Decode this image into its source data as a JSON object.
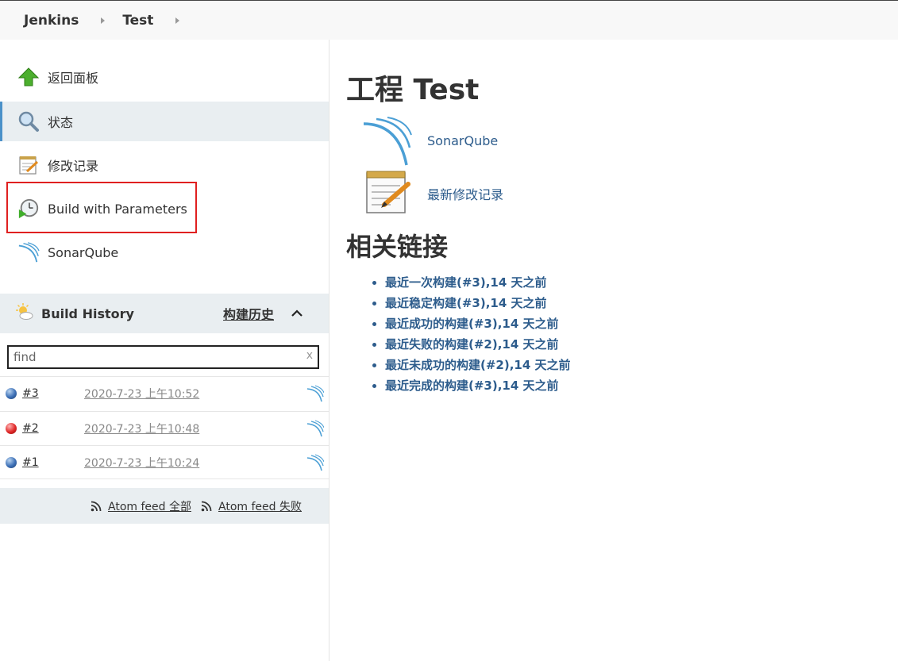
{
  "breadcrumb": {
    "items": [
      {
        "label": "Jenkins"
      },
      {
        "label": "Test"
      }
    ]
  },
  "sidebar": {
    "tasks": [
      {
        "label": "返回面板",
        "icon": "up-arrow-icon"
      },
      {
        "label": "状态",
        "icon": "search-icon",
        "active": true
      },
      {
        "label": "修改记录",
        "icon": "notepad-icon"
      },
      {
        "label": "Build with Parameters",
        "icon": "clock-play-icon"
      },
      {
        "label": "SonarQube",
        "icon": "sonarqube-icon"
      }
    ]
  },
  "build_history": {
    "title": "Build History",
    "trend_label": "构建历史",
    "search": {
      "placeholder": "find",
      "clear_label": "x"
    },
    "builds": [
      {
        "number": "#3",
        "date": "2020-7-23 上午10:52",
        "status_color": "blue"
      },
      {
        "number": "#2",
        "date": "2020-7-23 上午10:48",
        "status_color": "red"
      },
      {
        "number": "#1",
        "date": "2020-7-23 上午10:24",
        "status_color": "blue"
      }
    ],
    "feeds": {
      "all_label": "Atom feed 全部",
      "failed_label": "Atom feed 失败"
    }
  },
  "main": {
    "title": "工程 Test",
    "links": [
      {
        "label": "SonarQube",
        "icon": "sonarqube-icon"
      },
      {
        "label": "最新修改记录",
        "icon": "notepad-icon"
      }
    ],
    "related_title": "相关链接",
    "permalinks": [
      "最近一次构建(#3),14 天之前",
      "最近稳定构建(#3),14 天之前",
      "最近成功的构建(#3),14 天之前",
      "最近失败的构建(#2),14 天之前",
      "最近未成功的构建(#2),14 天之前",
      "最近完成的构建(#3),14 天之前"
    ]
  },
  "colors": {
    "link": "#2d5c8c",
    "active_task_bg": "#e9eef1",
    "highlight_box": "#e02020"
  }
}
